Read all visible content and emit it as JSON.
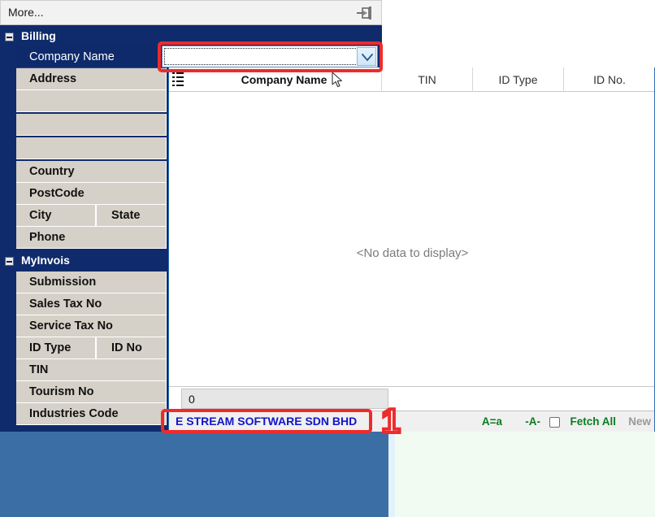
{
  "window": {
    "more_label": "More...",
    "pin_icon": "auto-hide-pin-icon"
  },
  "sidebar": {
    "groups": [
      {
        "title": "Billing",
        "expander_icon": "collapse-minus-icon",
        "rows": [
          {
            "label": "Company Name",
            "selected": true
          },
          {
            "label": "Address",
            "selected": false
          },
          {
            "label": "",
            "selected": false
          },
          {
            "label": "",
            "selected": false
          },
          {
            "label": "",
            "selected": false
          },
          {
            "label": "Country",
            "selected": false
          },
          {
            "label": "PostCode",
            "selected": false
          },
          {
            "label": "City",
            "label2": "State",
            "selected": false
          },
          {
            "label": "Phone",
            "selected": false
          }
        ]
      },
      {
        "title": "MyInvois",
        "expander_icon": "collapse-minus-icon",
        "rows": [
          {
            "label": "Submission",
            "selected": false
          },
          {
            "label": "Sales Tax No",
            "selected": false
          },
          {
            "label": "Service Tax No",
            "selected": false
          },
          {
            "label": "ID Type",
            "label2": "ID No",
            "selected": false
          },
          {
            "label": "TIN",
            "selected": false
          },
          {
            "label": "Tourism No",
            "selected": false
          },
          {
            "label": "Industries Code",
            "selected": false
          }
        ]
      }
    ]
  },
  "editor": {
    "name": "company-name-combobox",
    "value": "",
    "placeholder": "",
    "dropdown_icon": "chevron-down-icon",
    "focused": true
  },
  "lookup_grid": {
    "menu_icon": "grid-column-menu-icon",
    "columns": [
      {
        "label": "Company Name",
        "bold": true
      },
      {
        "label": "TIN",
        "bold": false
      },
      {
        "label": "ID Type",
        "bold": false
      },
      {
        "label": "ID No.",
        "bold": false
      }
    ],
    "empty_text": "<No data to display>",
    "footer_value": "0",
    "statusbar": {
      "company": "E STREAM SOFTWARE SDN BHD",
      "case_toggle": "A=a",
      "accent_toggle": "-A-",
      "fetch_all_label": "Fetch All",
      "fetch_all_checked": false,
      "new_label": "New",
      "new_enabled": false
    }
  },
  "annotations": [
    {
      "id": "combo-highlight",
      "color": "#ee2b2b"
    },
    {
      "id": "company-highlight",
      "color": "#ee2b2b"
    },
    {
      "id": "step-number",
      "label": "1",
      "color": "#ee2b2b"
    }
  ],
  "colors": {
    "band_navy": "#0f2b6b",
    "row_beige": "#d5d1c8",
    "desktop_blue": "#3b6ea5",
    "desktop_mint": "#f2fbf2",
    "status_green": "#0a7d21",
    "company_blue": "#1414c8",
    "annotation_red": "#ee2b2b"
  }
}
